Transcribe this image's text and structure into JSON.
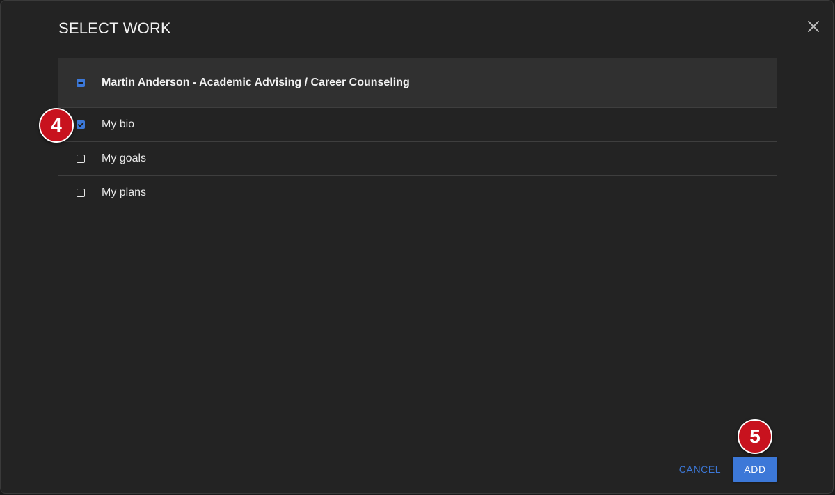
{
  "dialog": {
    "title": "SELECT WORK",
    "close_icon": "close-icon"
  },
  "group": {
    "label": "Martin Anderson - Academic Advising / Career Counseling",
    "state": "indeterminate"
  },
  "items": [
    {
      "label": "My bio",
      "checked": true
    },
    {
      "label": "My goals",
      "checked": false
    },
    {
      "label": "My plans",
      "checked": false
    }
  ],
  "markers": [
    {
      "number": "4"
    },
    {
      "number": "5"
    }
  ],
  "footer": {
    "cancel_label": "CANCEL",
    "add_label": "ADD"
  },
  "colors": {
    "accent": "#3c78d8",
    "marker": "#c8121e",
    "background": "#232323",
    "header_row": "#303030"
  }
}
